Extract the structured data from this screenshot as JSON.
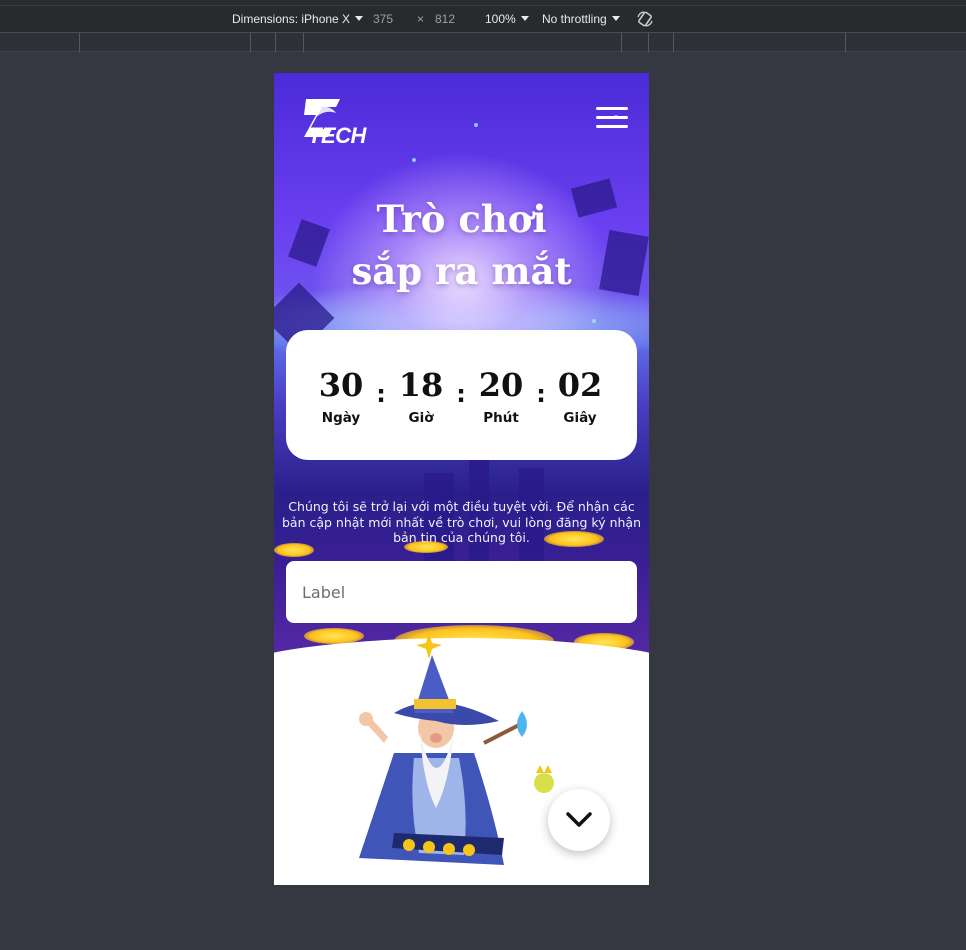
{
  "devtools": {
    "dimensions_label": "Dimensions: iPhone X",
    "width": "375",
    "times": "×",
    "height": "812",
    "zoom": "100%",
    "throttling": "No throttling"
  },
  "site": {
    "logo_text": "TECH",
    "title_line1": "Trò chơi",
    "title_line2": "sắp ra mắt",
    "countdown": [
      {
        "value": "30",
        "label": "Ngày"
      },
      {
        "value": "18",
        "label": "Giờ"
      },
      {
        "value": "20",
        "label": "Phút"
      },
      {
        "value": "02",
        "label": "Giây"
      }
    ],
    "separator": ":",
    "description": "Chúng tôi sẽ trở lại với một điều tuyệt vời. Để nhận các bản cập nhật mới nhất về trò chơi, vui lòng đăng ký nhận bản tin của chúng tôi.",
    "input_placeholder": "Label"
  },
  "icons": {
    "menu": "hamburger-menu-icon",
    "scroll": "chevron-down-icon",
    "rotate": "rotate-device-icon"
  },
  "colors": {
    "hero_top": "#4b2bd8",
    "hero_mid": "#6d54ee",
    "accent_glow": "#ffd21a",
    "devtools_bg": "#292a2d",
    "page_bg": "#353841"
  }
}
